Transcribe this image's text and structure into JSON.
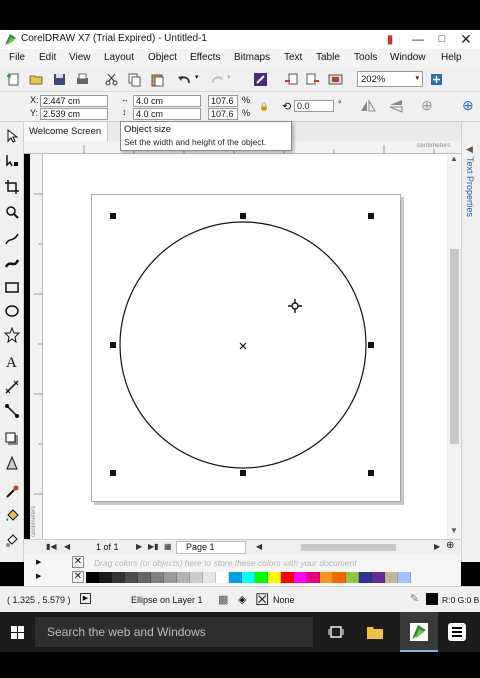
{
  "window": {
    "title": "CorelDRAW X7 (Trial Expired) - Untitled-1"
  },
  "menu": [
    "File",
    "Edit",
    "View",
    "Layout",
    "Object",
    "Effects",
    "Bitmaps",
    "Text",
    "Table",
    "Tools",
    "Window",
    "Help"
  ],
  "toolbar": {
    "zoom": "202%"
  },
  "property_bar": {
    "x_label": "X:",
    "x_value": "2.447 cm",
    "y_label": "Y:",
    "y_value": "2.539 cm",
    "width_value": "4.0 cm",
    "height_value": "4.0 cm",
    "scale_w": "107.6",
    "scale_h": "107.6",
    "percent": "%",
    "rotation": "0.0",
    "degree": "°"
  },
  "tabs": {
    "welcome": "Welcome Screen"
  },
  "tooltip": {
    "title": "Object size",
    "description": "Set the width and height of the object."
  },
  "ruler": {
    "unit_top": "centimeters",
    "unit_left": "centimeters"
  },
  "docker": {
    "label": "Text Properties"
  },
  "navigator": {
    "page_count": "1 of 1",
    "page_tab": "Page 1"
  },
  "palette": {
    "hint": "Drag colors (or objects) here to store these colors with your document",
    "colors": [
      "#000000",
      "#1a1a1a",
      "#333333",
      "#4d4d4d",
      "#666666",
      "#808080",
      "#999999",
      "#b3b3b3",
      "#cccccc",
      "#e6e6e6",
      "#ffffff",
      "#00a0e3",
      "#00ffff",
      "#00ff00",
      "#ffff00",
      "#ff0000",
      "#ff00ff",
      "#e6007e",
      "#f7941d",
      "#ff6600",
      "#8dc63f",
      "#2e3192",
      "#662d91",
      "#c2b59b",
      "#a0c4ff"
    ]
  },
  "status": {
    "coords": "( 1.325 , 5.579 )",
    "object": "Ellipse on Layer 1",
    "fill": "None",
    "outline": "R:0 G:0 B"
  },
  "taskbar": {
    "search_placeholder": "Search the web and Windows"
  }
}
